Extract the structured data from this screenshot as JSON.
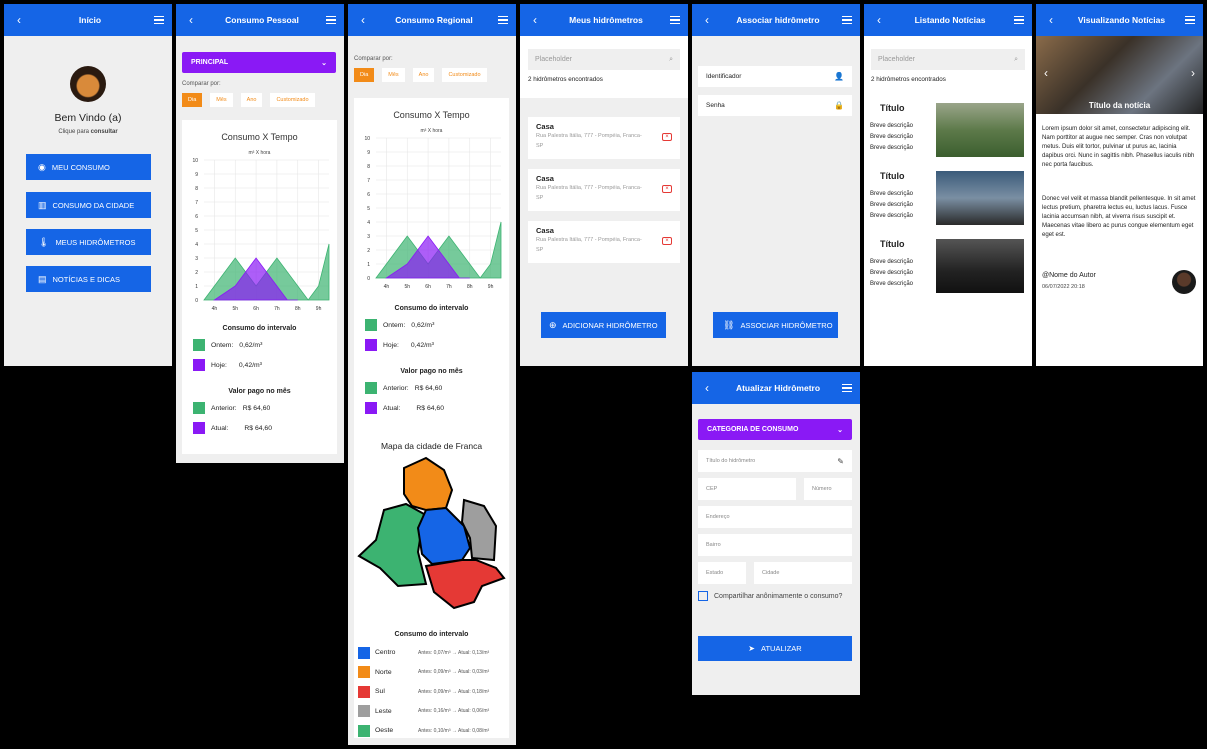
{
  "colors": {
    "appbar": "#1565e6",
    "orange": "#f28b18",
    "purple": "#8a19f5",
    "green": "#3cb371",
    "violet": "#8a19f5"
  },
  "s1": {
    "title": "Início",
    "welcome": "Bem Vindo (a)",
    "hint_prefix": "Clique para ",
    "hint_bold": "consultar",
    "buttons": [
      {
        "label": "MEU CONSUMO",
        "icon": "eye-icon"
      },
      {
        "label": "CONSUMO DA CIDADE",
        "icon": "map-icon"
      },
      {
        "label": "MEUS HIDRÔMETROS",
        "icon": "thermometer-icon"
      },
      {
        "label": "NOTÍCIAS E DICAS",
        "icon": "document-icon"
      }
    ]
  },
  "s2": {
    "title": "Consumo Pessoal",
    "dropdown": "PRINCIPAL",
    "compare": "Comparar por:",
    "chips": [
      "Dia",
      "Mês",
      "Ano",
      "Customizado"
    ],
    "interval": "Consumo do intervalo",
    "yesterday_label": "Ontem:",
    "yesterday_value": "0,62/m³",
    "today_label": "Hoje:",
    "today_value": "0,42/m³",
    "paid": "Valor pago no mês",
    "prev_label": "Anterior:",
    "prev_value": "R$ 64,60",
    "cur_label": "Atual:",
    "cur_value": "R$ 64,60"
  },
  "chart_data": {
    "type": "area",
    "title": "Consumo X Tempo",
    "ylabel": "m³ X hora",
    "xlabel": "",
    "categories": [
      "4h",
      "5h",
      "6h",
      "7h",
      "8h",
      "9h"
    ],
    "y_ticks": [
      "0",
      "1",
      "2",
      "3",
      "4",
      "5",
      "6",
      "7",
      "8",
      "9",
      "10"
    ],
    "ylim": [
      0,
      10
    ],
    "series": [
      {
        "x": [
          3.5,
          5,
          6,
          7,
          8.5,
          9,
          9.5
        ],
        "values": [
          0,
          3,
          1,
          3,
          0,
          1,
          4
        ],
        "color": "#3cb371"
      },
      {
        "x": [
          4,
          5,
          6,
          7.5,
          8
        ],
        "values": [
          0,
          1,
          3,
          0,
          0
        ],
        "color": "#8a19f5"
      }
    ],
    "grid": true
  },
  "s3": {
    "title": "Consumo Regional",
    "compare": "Comparar por:",
    "chips": [
      "Dia",
      "Mês",
      "Ano",
      "Customizado"
    ],
    "interval": "Consumo do intervalo",
    "yesterday_label": "Ontem:",
    "yesterday_value": "0,62/m³",
    "today_label": "Hoje:",
    "today_value": "0,42/m³",
    "paid": "Valor pago no mês",
    "prev_label": "Anterior:",
    "prev_value": "R$ 64,60",
    "cur_label": "Atual:",
    "cur_value": "R$ 64,60",
    "map_title": "Mapa da cidade de Franca",
    "interval2": "Consumo do intervalo",
    "regions": [
      {
        "name": "Centro",
        "color": "#1565e6",
        "text": "Antes: 0,07/m³ → Atual: 0,13/m³"
      },
      {
        "name": "Norte",
        "color": "#f28b18",
        "text": "Antes: 0,09/m³ → Atual: 0,03/m³"
      },
      {
        "name": "Sul",
        "color": "#e53935",
        "text": "Antes: 0,09/m³ → Atual: 0,18/m³"
      },
      {
        "name": "Leste",
        "color": "#9e9e9e",
        "text": "Antes: 0,16/m³ → Atual: 0,06/m³"
      },
      {
        "name": "Oeste",
        "color": "#3cb371",
        "text": "Antes: 0,10/m³ → Atual: 0,08/m³"
      }
    ]
  },
  "s4": {
    "title": "Meus hidrômetros",
    "placeholder": "Placeholder",
    "count": "2 hidrômetros encontrados",
    "items": [
      {
        "name": "Casa",
        "address": "Rua Palestra Itália, 777 - Pompéia, Franca-SP"
      },
      {
        "name": "Casa",
        "address": "Rua Palestra Itália, 777 - Pompéia, Franca-SP"
      },
      {
        "name": "Casa",
        "address": "Rua Palestra Itália, 777 - Pompéia, Franca-SP"
      }
    ],
    "add": "ADICIONAR HIDRÔMETRO"
  },
  "s5": {
    "title": "Associar hidrômetro",
    "id_label": "Identificador",
    "pw_label": "Senha",
    "assoc": "ASSOCIAR HIDRÔMETRO"
  },
  "s6": {
    "title": "Listando Notícias",
    "placeholder": "Placeholder",
    "count": "2 hidrômetros encontrados",
    "items": [
      {
        "title": "Título",
        "desc": "Breve descrição"
      },
      {
        "title": "Título",
        "desc": "Breve descrição"
      },
      {
        "title": "Título",
        "desc": "Breve descrição"
      }
    ]
  },
  "s7": {
    "title": "Visualizando Notícias",
    "hero_title": "Título da notícia",
    "p1": "Lorem ipsum dolor sit amet, consectetur adipiscing elit. Nam porttitor at augue nec semper. Cras non volutpat metus. Duis elit tortor, pulvinar ut purus ac, lacinia dapibus orci. Nunc in sagittis nibh. Phasellus iaculis nibh nec porta faucibus.",
    "p2": "Donec vel velit et massa blandit pellentesque. In sit amet lectus pretium, pharetra lectus eu, luctus lacus. Fusce lacinia accumsan nibh, at viverra risus suscipit et. Maecenas vitae libero ac purus congue elementum eget eget est.",
    "author": "@Nome do Autor",
    "date": "06/07/2022 20:18"
  },
  "s8": {
    "title": "Atualizar Hidrômetro",
    "dropdown": "CATEGORIA DE CONSUMO",
    "f_title": "Título do hidrômetro",
    "f_cep": "CEP",
    "f_num": "Número",
    "f_end": "Endereço",
    "f_bairro": "Bairro",
    "f_estado": "Estado",
    "f_cidade": "Cidade",
    "share": "Compartilhar anônimamente o consumo?",
    "update": "ATUALIZAR"
  }
}
